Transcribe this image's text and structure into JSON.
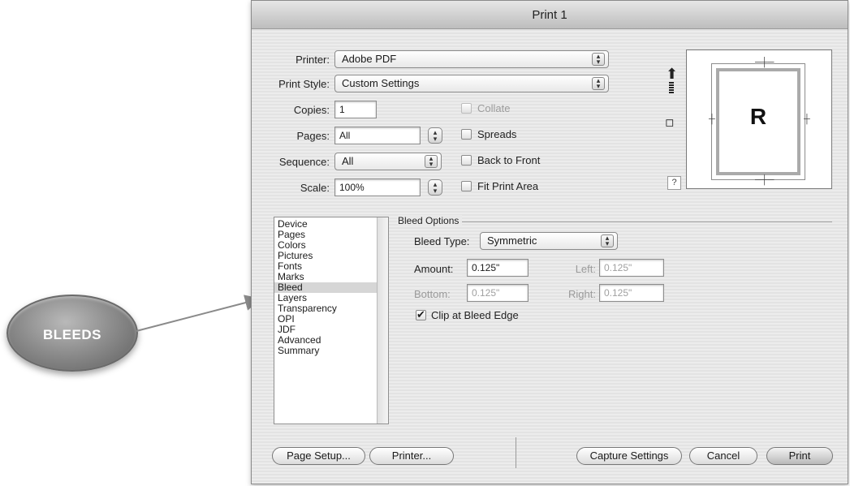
{
  "callout": {
    "label": "BLEEDS"
  },
  "window": {
    "title": "Print 1"
  },
  "printer": {
    "label": "Printer:",
    "value": "Adobe PDF"
  },
  "print_style": {
    "label": "Print Style:",
    "value": "Custom Settings"
  },
  "copies": {
    "label": "Copies:",
    "value": "1"
  },
  "pages": {
    "label": "Pages:",
    "value": "All"
  },
  "sequence": {
    "label": "Sequence:",
    "value": "All"
  },
  "scale": {
    "label": "Scale:",
    "value": "100%"
  },
  "options": {
    "collate": {
      "label": "Collate",
      "checked": false,
      "enabled": false
    },
    "spreads": {
      "label": "Spreads",
      "checked": false
    },
    "back_to_front": {
      "label": "Back to Front",
      "checked": false
    },
    "fit_print_area": {
      "label": "Fit Print Area",
      "checked": false
    }
  },
  "preview": {
    "letter": "R",
    "help": "?"
  },
  "sidebar": {
    "items": [
      {
        "label": "Device"
      },
      {
        "label": "Pages"
      },
      {
        "label": "Colors"
      },
      {
        "label": "Pictures"
      },
      {
        "label": "Fonts"
      },
      {
        "label": "Marks"
      },
      {
        "label": "Bleed",
        "selected": true
      },
      {
        "label": "Layers"
      },
      {
        "label": "Transparency"
      },
      {
        "label": "OPI"
      },
      {
        "label": "JDF"
      },
      {
        "label": "Advanced"
      },
      {
        "label": "Summary"
      }
    ]
  },
  "bleed": {
    "section_title": "Bleed Options",
    "type_label": "Bleed Type:",
    "type_value": "Symmetric",
    "amount_label": "Amount:",
    "amount_value": "0.125\"",
    "left_label": "Left:",
    "left_value": "0.125\"",
    "bottom_label": "Bottom:",
    "bottom_value": "0.125\"",
    "right_label": "Right:",
    "right_value": "0.125\"",
    "clip_label": "Clip at Bleed Edge",
    "clip_checked": true
  },
  "buttons": {
    "page_setup": "Page Setup...",
    "printer": "Printer...",
    "capture_settings": "Capture Settings",
    "cancel": "Cancel",
    "print": "Print"
  },
  "colors": {
    "callout": "#8e8e8e",
    "window_bg": "#e9e9e9",
    "arrow": "#8a8a8a"
  }
}
